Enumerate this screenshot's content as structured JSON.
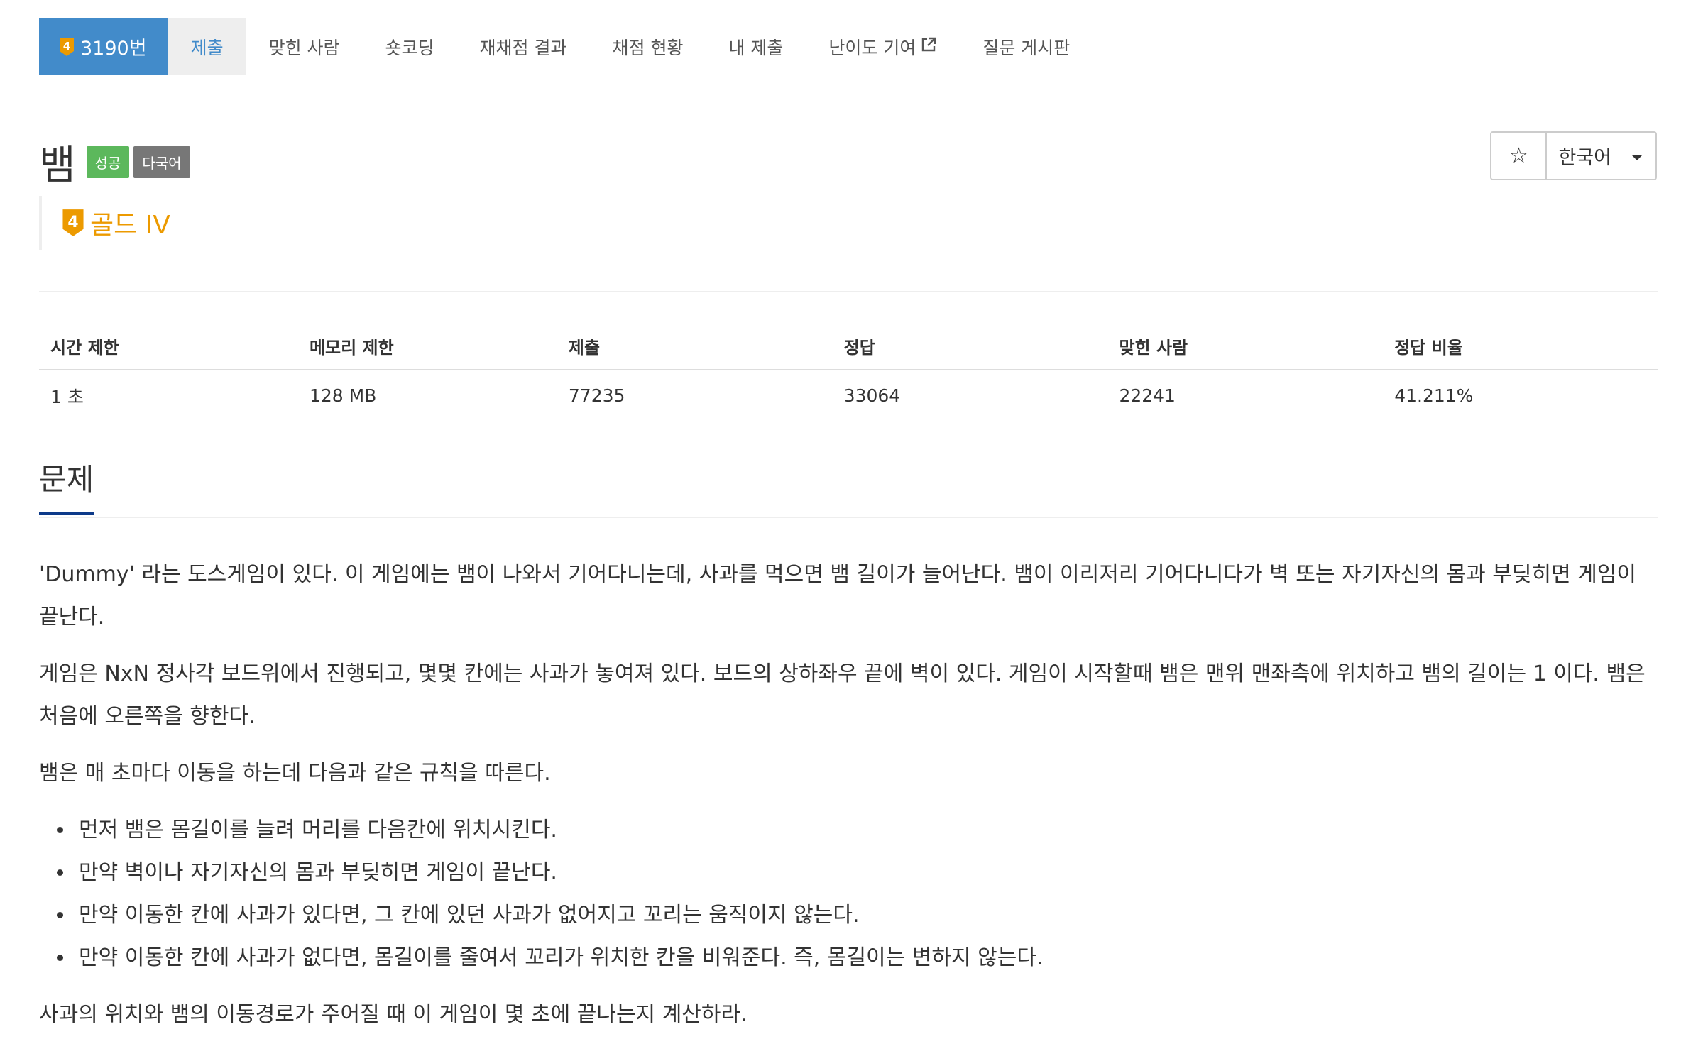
{
  "menu": {
    "problem_number": "3190번",
    "items": [
      "제출",
      "맞힌 사람",
      "숏코딩",
      "재채점 결과",
      "채점 현황",
      "내 제출",
      "난이도 기여",
      "질문 게시판"
    ]
  },
  "tier": {
    "level_digit": "4",
    "name": "골드 IV",
    "color": "#ec9a00"
  },
  "title": "뱀",
  "labels": {
    "status": "성공",
    "multilang": "다국어"
  },
  "controls": {
    "language": "한국어"
  },
  "info_table": {
    "headers": [
      "시간 제한",
      "메모리 제한",
      "제출",
      "정답",
      "맞힌 사람",
      "정답 비율"
    ],
    "values": [
      "1 초",
      "128 MB",
      "77235",
      "33064",
      "22241",
      "41.211%"
    ]
  },
  "section": {
    "headline": "문제"
  },
  "problem": {
    "p1": "'Dummy' 라는 도스게임이 있다. 이 게임에는 뱀이 나와서 기어다니는데, 사과를 먹으면 뱀 길이가 늘어난다. 뱀이 이리저리 기어다니다가 벽 또는 자기자신의 몸과 부딪히면 게임이 끝난다.",
    "p2": "게임은 NxN 정사각 보드위에서 진행되고, 몇몇 칸에는 사과가 놓여져 있다. 보드의 상하좌우 끝에 벽이 있다. 게임이 시작할때 뱀은 맨위 맨좌측에 위치하고 뱀의 길이는 1 이다. 뱀은 처음에 오른쪽을 향한다.",
    "p3": "뱀은 매 초마다 이동을 하는데 다음과 같은 규칙을 따른다.",
    "rules": [
      "먼저 뱀은 몸길이를 늘려 머리를 다음칸에 위치시킨다.",
      "만약 벽이나 자기자신의 몸과 부딪히면 게임이 끝난다.",
      "만약 이동한 칸에 사과가 있다면, 그 칸에 있던 사과가 없어지고 꼬리는 움직이지 않는다.",
      "만약 이동한 칸에 사과가 없다면, 몸길이를 줄여서 꼬리가 위치한 칸을 비워준다. 즉, 몸길이는 변하지 않는다."
    ],
    "p4": "사과의 위치와 뱀의 이동경로가 주어질 때 이 게임이 몇 초에 끝나는지 계산하라."
  },
  "colors": {
    "primary": "#428bca",
    "success": "#5cb85c",
    "gold": "#ec9a00",
    "headline_underline": "#0d3a89"
  },
  "icons": {
    "star": "star-outline-icon",
    "external": "external-link-icon",
    "tier": "gold-tier-badge-icon"
  }
}
